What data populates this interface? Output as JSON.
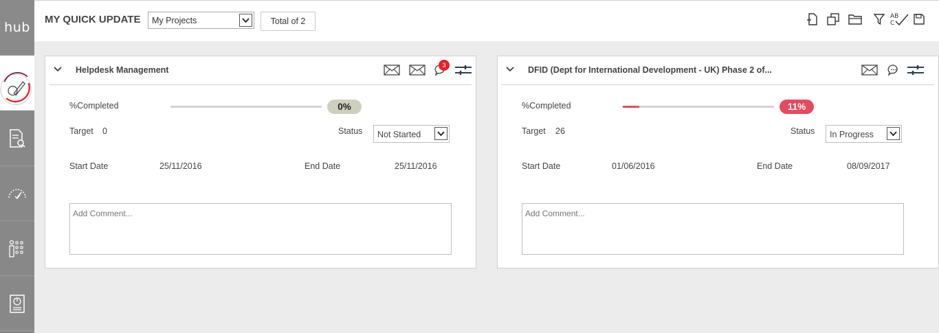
{
  "app": {
    "logo": "hub"
  },
  "header": {
    "title": "MY QUICK UPDATE",
    "project_filter": "My Projects",
    "total_label": "Total of 2"
  },
  "cards": [
    {
      "title": "Helpdesk Management",
      "comment_count": "3",
      "completed_label": "%Completed",
      "percent_text": "0%",
      "percent_value": 0,
      "target_label": "Target",
      "target_value": "0",
      "status_label": "Status",
      "status_value": "Not Started",
      "start_label": "Start Date",
      "start_value": "25/11/2016",
      "end_label": "End Date",
      "end_value": "25/11/2016",
      "comment_placeholder": "Add Comment..."
    },
    {
      "title": "DFID (Dept for International Development - UK) Phase 2 of...",
      "completed_label": "%Completed",
      "percent_text": "11%",
      "percent_value": 11,
      "target_label": "Target",
      "target_value": "26",
      "status_label": "Status",
      "status_value": "In Progress",
      "start_label": "Start Date",
      "start_value": "01/06/2016",
      "end_label": "End Date",
      "end_value": "08/09/2017",
      "comment_placeholder": "Add Comment..."
    }
  ],
  "colors": {
    "sidebar": "#888888",
    "accent_red": "#e64a5d",
    "badge_red": "#e8202a",
    "pill_grey": "#cfcfbf"
  },
  "icons": {
    "sidebar": [
      "quick-update-icon",
      "search-document-icon",
      "dashboard-gauge-icon",
      "resource-icon",
      "report-icon"
    ],
    "toolbar": [
      "add-document-icon",
      "copy-icon",
      "folder-icon",
      "filter-icon",
      "spellcheck-icon",
      "save-icon"
    ],
    "card": [
      "collapse-chevron-icon",
      "email-icon",
      "comment-icon",
      "settings-sliders-icon"
    ]
  }
}
